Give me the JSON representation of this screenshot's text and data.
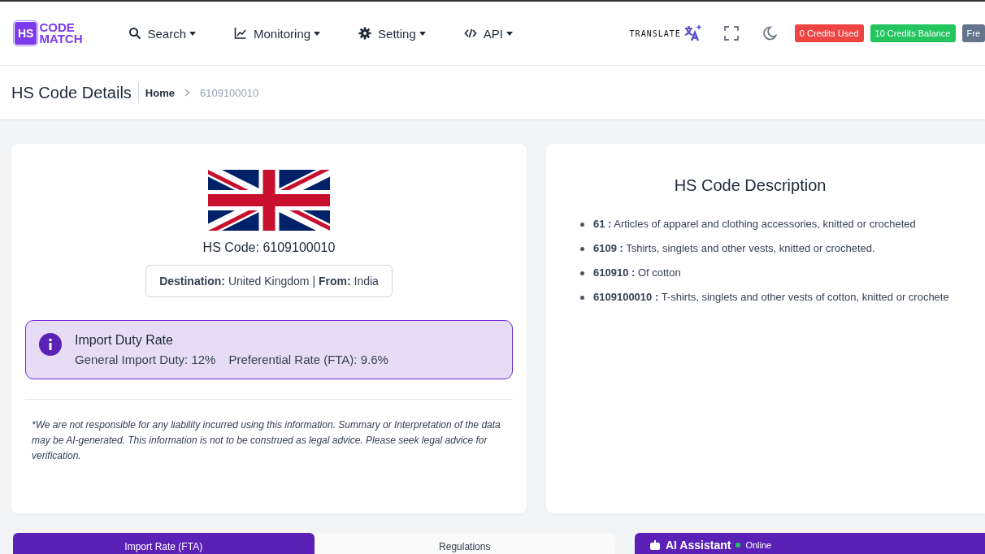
{
  "logo": {
    "badge": "HS",
    "line_1": "CODE",
    "line_2": "MATCH"
  },
  "nav": [
    {
      "label": "Search",
      "kind": "search"
    },
    {
      "label": "Monitoring",
      "kind": "chart"
    },
    {
      "label": "Setting",
      "kind": "gear"
    },
    {
      "label": "API",
      "kind": "code"
    }
  ],
  "translate": {
    "label": "TRANSLATE"
  },
  "badges": [
    {
      "label": "0 Credits Used",
      "color": "#ef4444"
    },
    {
      "label": "10 Credits Balance",
      "color": "#22c55e"
    },
    {
      "label": "Fre",
      "color": "#64748b"
    }
  ],
  "page_header": {
    "title": "HS Code Details",
    "breadcrumb": [
      "Home",
      "6109100010"
    ]
  },
  "code_card": {
    "hs_code": "HS Code: 6109100010",
    "route": "**Destination:** United Kingdom | **From:** India",
    "duty": {
      "title": "Import Duty Rate",
      "general": "General Import Duty: 12%",
      "preferential": "Preferential Rate (FTA): 9.6%"
    },
    "disclaimer": "*We are not responsible for any liability incurred using this information. Summary or Interpretation of the data may be AI-generated. This information is not to be construed as legal advice. Please seek legal advice for verification."
  },
  "description": {
    "title": "HS Code Description",
    "items": [
      "**61 :** Articles of apparel and clothing accessories, knitted or crocheted",
      "**6109 :** Tshirts, singlets and other vests, knitted or crocheted.",
      "**610910 :** Of cotton",
      "**6109100010 :** T-shirts, singlets and other vests of cotton, knitted or crochete"
    ]
  },
  "tabs": [
    {
      "label": "Import Rate (FTA)",
      "selected": true
    },
    {
      "label": "Regulations",
      "selected": false
    }
  ],
  "assistant": {
    "title": "AI Assistant",
    "status": "Online"
  }
}
